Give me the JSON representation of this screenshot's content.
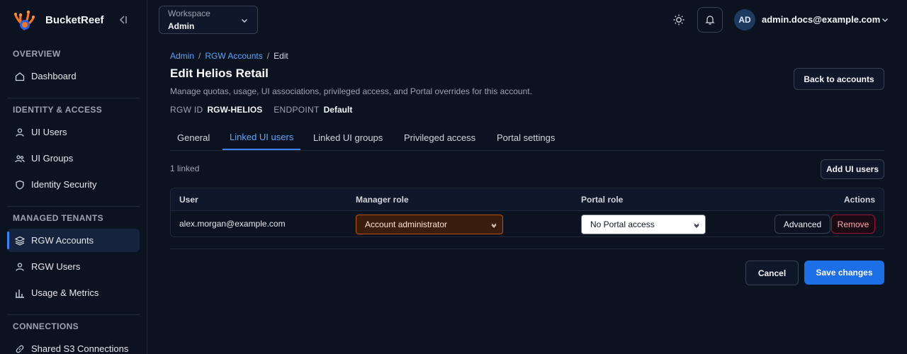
{
  "brand": {
    "name": "BucketReef"
  },
  "sidebar": {
    "sections": [
      {
        "title": "OVERVIEW",
        "items": [
          {
            "label": "Dashboard",
            "icon": "home-icon"
          }
        ]
      },
      {
        "title": "IDENTITY & ACCESS",
        "items": [
          {
            "label": "UI Users",
            "icon": "user-icon"
          },
          {
            "label": "UI Groups",
            "icon": "users-icon"
          },
          {
            "label": "Identity Security",
            "icon": "shield-icon"
          }
        ]
      },
      {
        "title": "MANAGED TENANTS",
        "items": [
          {
            "label": "RGW Accounts",
            "icon": "layers-icon",
            "active": true
          },
          {
            "label": "RGW Users",
            "icon": "user-icon"
          },
          {
            "label": "Usage & Metrics",
            "icon": "bar-chart-icon"
          }
        ]
      },
      {
        "title": "CONNECTIONS",
        "items": [
          {
            "label": "Shared S3 Connections",
            "icon": "link-icon"
          }
        ]
      }
    ]
  },
  "header": {
    "workspace_label": "Workspace",
    "workspace_value": "Admin",
    "avatar_initials": "AD",
    "user_email": "admin.docs@example.com"
  },
  "breadcrumb": {
    "root": "Admin",
    "section": "RGW Accounts",
    "current": "Edit"
  },
  "page": {
    "title": "Edit Helios Retail",
    "description": "Manage quotas, usage, UI associations, privileged access, and Portal overrides for this account.",
    "rgw_id_label": "RGW ID",
    "rgw_id": "RGW-HELIOS",
    "endpoint_label": "ENDPOINT",
    "endpoint": "Default",
    "back_button": "Back to accounts"
  },
  "tabs": [
    {
      "label": "General"
    },
    {
      "label": "Linked UI users",
      "active": true
    },
    {
      "label": "Linked UI groups"
    },
    {
      "label": "Privileged access"
    },
    {
      "label": "Portal settings"
    }
  ],
  "linked": {
    "count_text": "1 linked",
    "add_button": "Add UI users",
    "columns": {
      "user": "User",
      "manager_role": "Manager role",
      "portal_role": "Portal role",
      "actions": "Actions"
    },
    "rows": [
      {
        "user": "alex.morgan@example.com",
        "manager_role": "Account administrator",
        "portal_role": "No Portal access",
        "advanced_label": "Advanced",
        "remove_label": "Remove"
      }
    ]
  },
  "footer": {
    "cancel": "Cancel",
    "save": "Save changes"
  },
  "colors": {
    "accent": "#3b82f6",
    "primary_button": "#1d6fe8",
    "danger": "#fda4af",
    "warning_select": "#b45309"
  }
}
